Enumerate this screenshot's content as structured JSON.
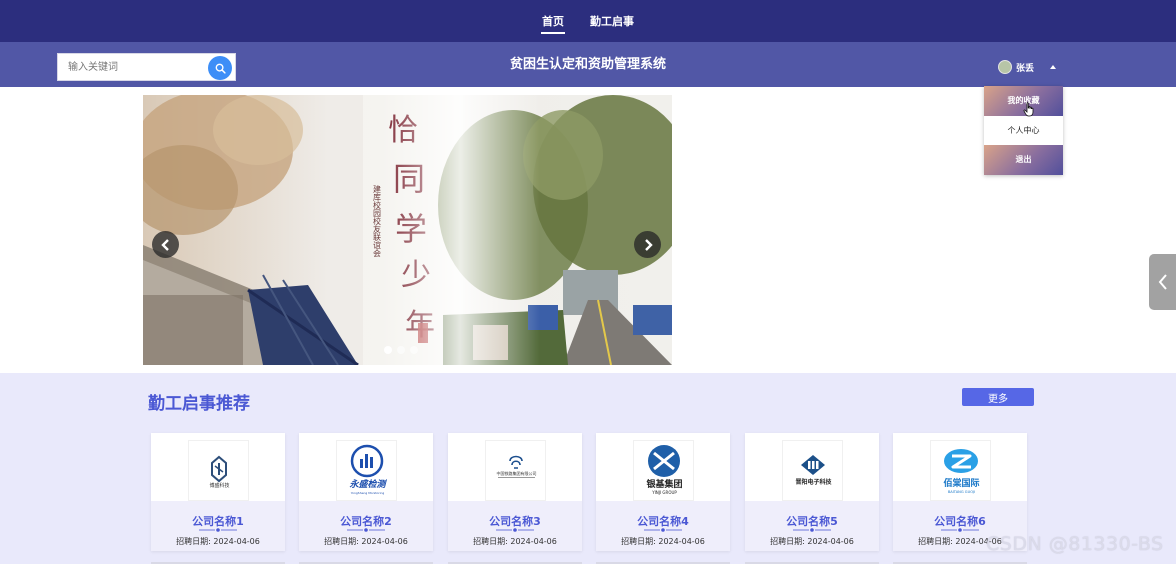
{
  "nav": {
    "items": [
      {
        "label": "首页",
        "active": true
      },
      {
        "label": "勤工启事",
        "active": false
      }
    ]
  },
  "header": {
    "search_placeholder": "输入关键词",
    "site_title": "贫困生认定和资助管理系统",
    "user_name": "张丢"
  },
  "dropdown": {
    "items": [
      {
        "label": "我的收藏"
      },
      {
        "label": "个人中心"
      },
      {
        "label": "退出"
      }
    ]
  },
  "banner": {
    "calligraphy": "恰同学少年",
    "subtext": "建库校园校友联谊会",
    "slide_count": 3,
    "active_slide": 1
  },
  "section": {
    "title": "勤工启事推荐",
    "more_label": "更多",
    "cards": [
      {
        "name": "公司名称1",
        "date": "招聘日期: 2024-04-06",
        "logo": "pillar-logo"
      },
      {
        "name": "公司名称2",
        "date": "招聘日期: 2024-04-06",
        "logo": "yongsheng-logo"
      },
      {
        "name": "公司名称3",
        "date": "招聘日期: 2024-04-06",
        "logo": "text-company-logo"
      },
      {
        "name": "公司名称4",
        "date": "招聘日期: 2024-04-06",
        "logo": "yinji-logo"
      },
      {
        "name": "公司名称5",
        "date": "招聘日期: 2024-04-06",
        "logo": "electronic-tech-logo"
      },
      {
        "name": "公司名称6",
        "date": "招聘日期: 2024-04-06",
        "logo": "baitang-logo"
      }
    ],
    "logo_texts": {
      "card1": "博盛科技",
      "card2_main": "永盛检测",
      "card2_sub": "YongSheng Monitoring",
      "card3": "中国铁路集团有限公司",
      "card4_main": "银基集团",
      "card4_sub": "YINJI GROUP",
      "card5": "晋阳电子科技",
      "card6_main": "佰棠国际",
      "card6_sub": "BAITANG GUOJI"
    }
  },
  "watermark": "CSDN @81330-BS",
  "colors": {
    "topnav": "#2c2e7e",
    "headerbar": "#5157a6",
    "accent": "#4b58d4",
    "section_bg": "#e9e9fb",
    "more_button": "#5667e6",
    "search_button": "#3d8ef7"
  }
}
